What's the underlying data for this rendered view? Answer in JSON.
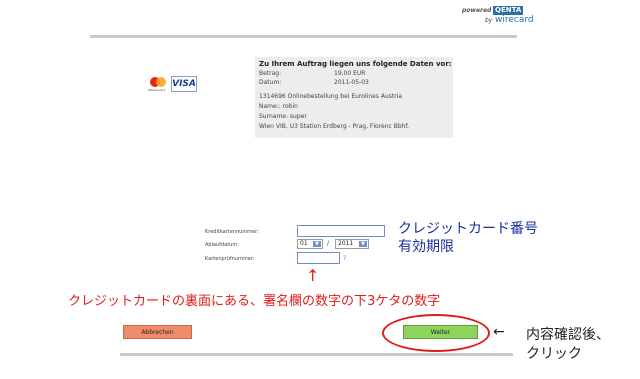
{
  "header": {
    "powered_label": "powered",
    "brand": "QENTA",
    "by_label": "by",
    "provider": "wirecard"
  },
  "cards": {
    "mastercard_label": "MasterCard",
    "visa_label": "VISA"
  },
  "order": {
    "heading": "Zu Ihrem Auftrag liegen uns folgende Daten vor:",
    "amount_label": "Betrag:",
    "amount_value": "19,00  EUR",
    "date_label": "Datum:",
    "date_value": "2011-05-03",
    "description": "1314696 Onlinebestellung bei Eurolines Austria",
    "name_line": "Name:: robin",
    "surname_line": "Surname: super",
    "route_line": "Wien VIB, U3 Station Erdberg - Prag, Florenc Bbhf."
  },
  "form": {
    "card_number_label": "Kreditkartennummer:",
    "card_number_value": "",
    "expiry_label": "Ablaufdatum:",
    "expiry_month": "01",
    "expiry_sep": "/",
    "expiry_year": "2011",
    "cvc_label": "Kartenprüfnummer:",
    "cvc_value": "",
    "help": "?"
  },
  "annotations": {
    "card_number_jp": "クレジットカード番号",
    "expiry_jp": "有効期限",
    "arrow_up": "↑",
    "cvc_jp": "クレジットカードの裏面にある、署名欄の数字の下3ケタの数字",
    "arrow_left": "←",
    "confirm_jp_1": "内容確認後、",
    "confirm_jp_2": "クリック"
  },
  "buttons": {
    "cancel": "Abbrechen",
    "next": "Weiter"
  },
  "colors": {
    "accent_blue": "#1a2f9e",
    "annotation_red": "#e11b1b",
    "cancel_bg": "#f08c6c",
    "next_bg": "#8ed35c"
  }
}
